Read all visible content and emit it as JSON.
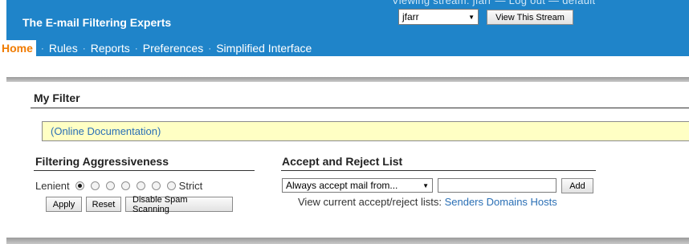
{
  "header": {
    "brand": "The E-mail Filtering Experts",
    "cutoff_text": "Viewing stream: jfarr  —  Log out  —  default",
    "stream_select": {
      "value": "jfarr"
    },
    "view_button": "View This Stream",
    "colors": {
      "bar": "#1f84c9",
      "home_active": "#f07b00"
    }
  },
  "nav": {
    "items": [
      {
        "label": "Home",
        "active": true
      },
      {
        "label": "Rules"
      },
      {
        "label": "Reports"
      },
      {
        "label": "Preferences"
      },
      {
        "label": "Simplified Interface"
      }
    ],
    "separator": "·"
  },
  "main": {
    "title": "My Filter",
    "doc_link": "(Online Documentation)",
    "aggressiveness": {
      "title": "Filtering Aggressiveness",
      "left_label": "Lenient",
      "right_label": "Strict",
      "levels": 7,
      "selected_index": 0,
      "buttons": {
        "apply": "Apply",
        "reset": "Reset",
        "disable": "Disable Spam Scanning"
      }
    },
    "accept_reject": {
      "title": "Accept and Reject List",
      "rule_select": "Always accept mail from...",
      "address_input_value": "",
      "add_button": "Add",
      "lists_prefix": "View current accept/reject lists:",
      "lists": {
        "senders": "Senders",
        "domains": "Domains",
        "hosts": "Hosts"
      }
    }
  }
}
